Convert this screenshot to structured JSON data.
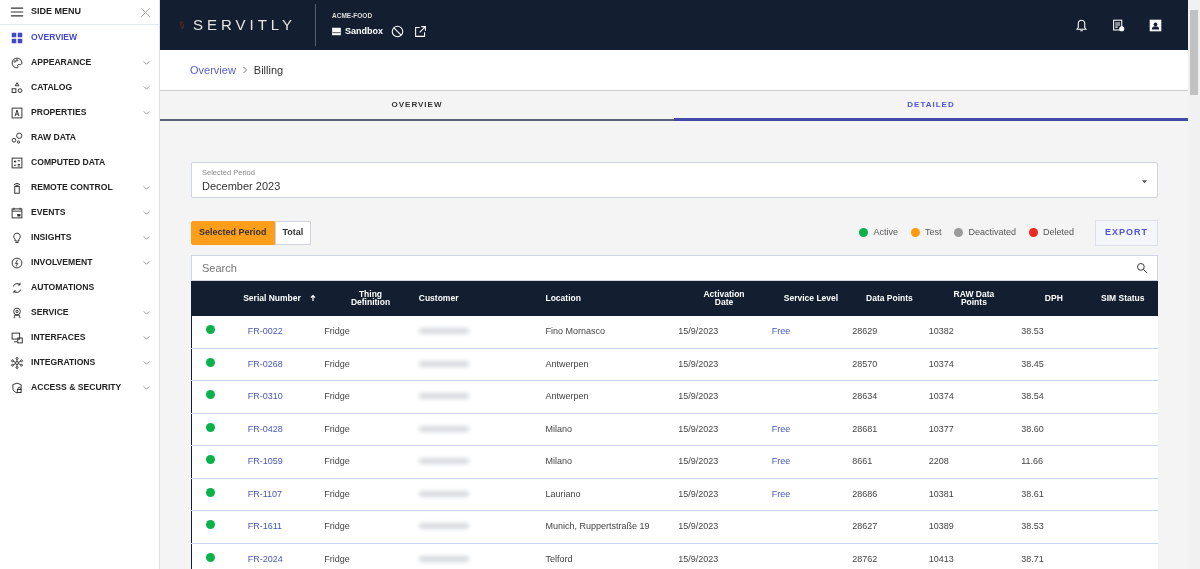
{
  "sidebar": {
    "title": "SIDE MENU",
    "items": [
      {
        "label": "OVERVIEW",
        "selected": true,
        "expandable": false
      },
      {
        "label": "APPEARANCE",
        "selected": false,
        "expandable": true
      },
      {
        "label": "CATALOG",
        "selected": false,
        "expandable": true
      },
      {
        "label": "PROPERTIES",
        "selected": false,
        "expandable": true
      },
      {
        "label": "RAW DATA",
        "selected": false,
        "expandable": false
      },
      {
        "label": "COMPUTED DATA",
        "selected": false,
        "expandable": false
      },
      {
        "label": "REMOTE CONTROL",
        "selected": false,
        "expandable": true
      },
      {
        "label": "EVENTS",
        "selected": false,
        "expandable": true
      },
      {
        "label": "INSIGHTS",
        "selected": false,
        "expandable": true
      },
      {
        "label": "INVOLVEMENT",
        "selected": false,
        "expandable": true
      },
      {
        "label": "AUTOMATIONS",
        "selected": false,
        "expandable": false
      },
      {
        "label": "SERVICE",
        "selected": false,
        "expandable": true
      },
      {
        "label": "INTERFACES",
        "selected": false,
        "expandable": true
      },
      {
        "label": "INTEGRATIONS",
        "selected": false,
        "expandable": true
      },
      {
        "label": "ACCESS & SECURITY",
        "selected": false,
        "expandable": true
      }
    ]
  },
  "header": {
    "logo": "SERVITLY",
    "tenant": "ACME-FOOD",
    "environment": "Sandbox"
  },
  "breadcrumb": [
    {
      "label": "Overview",
      "kind": "link"
    },
    {
      "label": "Billing",
      "kind": "current"
    }
  ],
  "tabs": [
    {
      "label": "OVERVIEW",
      "selected": false
    },
    {
      "label": "DETAILED",
      "selected": true
    }
  ],
  "period": {
    "label": "Selected Period",
    "value": "December 2023"
  },
  "toggle": [
    {
      "label": "Selected Period",
      "selected": true
    },
    {
      "label": "Total",
      "selected": false
    }
  ],
  "legend": [
    {
      "label": "Active",
      "color": "#0bb24c"
    },
    {
      "label": "Test",
      "color": "#ff9b0f"
    },
    {
      "label": "Deactivated",
      "color": "#9b9b9b"
    },
    {
      "label": "Deleted",
      "color": "#f0281d"
    }
  ],
  "export_button": "EXPORT",
  "search": {
    "placeholder": "Search"
  },
  "table": {
    "columns": [
      {
        "label": "Serial Number",
        "sorted": true
      },
      {
        "label": "Thing Definition",
        "sorted": false
      },
      {
        "label": "Customer",
        "sorted": false
      },
      {
        "label": "Location",
        "sorted": false
      },
      {
        "label": "Activation Date",
        "sorted": false
      },
      {
        "label": "Service Level",
        "sorted": false
      },
      {
        "label": "Data Points",
        "sorted": false
      },
      {
        "label": "RAW Data Points",
        "sorted": false
      },
      {
        "label": "DPH",
        "sorted": false
      },
      {
        "label": "SIM Status",
        "sorted": false
      }
    ],
    "rows": [
      {
        "color": "#0bb24c",
        "cells": [
          "FR-0022",
          "Fridge",
          "",
          "Fino Mornasco",
          "15/9/2023",
          "Free",
          "28629",
          "10382",
          "38.53",
          ""
        ]
      },
      {
        "color": "#0bb24c",
        "cells": [
          "FR-0268",
          "Fridge",
          "",
          "Antwerpen",
          "15/9/2023",
          "",
          "28570",
          "10374",
          "38.45",
          ""
        ]
      },
      {
        "color": "#0bb24c",
        "cells": [
          "FR-0310",
          "Fridge",
          "",
          "Antwerpen",
          "15/9/2023",
          "",
          "28634",
          "10374",
          "38.54",
          ""
        ]
      },
      {
        "color": "#0bb24c",
        "cells": [
          "FR-0428",
          "Fridge",
          "",
          "Milano",
          "15/9/2023",
          "Free",
          "28681",
          "10377",
          "38.60",
          ""
        ]
      },
      {
        "color": "#0bb24c",
        "cells": [
          "FR-1059",
          "Fridge",
          "",
          "Milano",
          "15/9/2023",
          "Free",
          "8661",
          "2208",
          "11.66",
          ""
        ]
      },
      {
        "color": "#0bb24c",
        "cells": [
          "FR-1107",
          "Fridge",
          "",
          "Lauriano",
          "15/9/2023",
          "Free",
          "28686",
          "10381",
          "38.61",
          ""
        ]
      },
      {
        "color": "#0bb24c",
        "cells": [
          "FR-1611",
          "Fridge",
          "",
          "Munich, Ruppertstraße 19",
          "15/9/2023",
          "",
          "28627",
          "10389",
          "38.53",
          ""
        ]
      },
      {
        "color": "#0bb24c",
        "cells": [
          "FR-2024",
          "Fridge",
          "",
          "Telford",
          "15/9/2023",
          "",
          "28762",
          "10413",
          "38.71",
          ""
        ]
      }
    ]
  }
}
